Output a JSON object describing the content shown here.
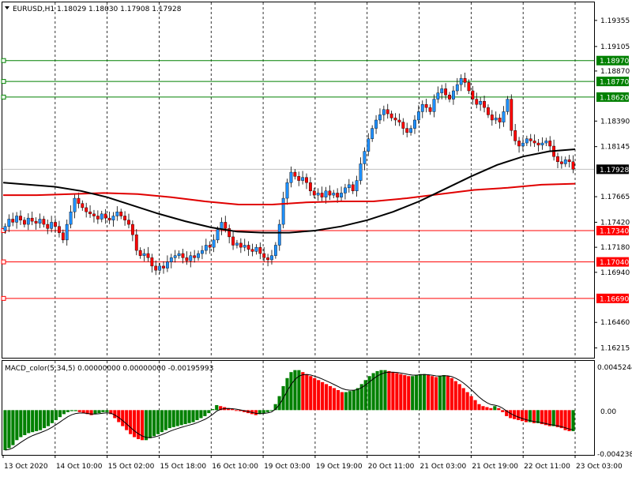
{
  "header": {
    "triangle_icon": "triangle-down-icon",
    "text": "EURUSD,H1  1.18029 1.18030 1.17908 1.17928"
  },
  "macd": {
    "label": "MACD_color(5,34,5) 0.00000000 0.00000000 -0.00195993",
    "max_label": "0.0045244",
    "zero_label": "0.00",
    "min_label": "-0.004238",
    "range": [
      -0.004238,
      0.0045244
    ],
    "values": [
      -0.004,
      -0.0038,
      -0.0035,
      -0.003,
      -0.0027,
      -0.0025,
      -0.0023,
      -0.0022,
      -0.0021,
      -0.002,
      -0.0018,
      -0.0016,
      -0.0013,
      -0.001,
      -0.0007,
      -0.0004,
      -0.0002,
      -0.0001,
      -0.0001,
      -0.0002,
      -0.0003,
      -0.0004,
      -0.0005,
      -0.0004,
      -0.0003,
      -0.0002,
      -0.0002,
      -0.0004,
      -0.0008,
      -0.0012,
      -0.0016,
      -0.002,
      -0.0024,
      -0.0027,
      -0.0029,
      -0.003,
      -0.003,
      -0.0028,
      -0.0026,
      -0.0024,
      -0.0022,
      -0.002,
      -0.0018,
      -0.0017,
      -0.0016,
      -0.0015,
      -0.0014,
      -0.0013,
      -0.0012,
      -0.001,
      -0.0008,
      -0.0006,
      -0.0003,
      0.0001,
      0.0005,
      0.0004,
      0.0003,
      0.0002,
      0.0001,
      0.0,
      -0.0001,
      -0.0002,
      -0.0003,
      -0.0004,
      -0.0005,
      -0.0004,
      -0.0003,
      -0.0002,
      0.0,
      0.0006,
      0.0014,
      0.0024,
      0.0032,
      0.0038,
      0.004,
      0.004,
      0.0038,
      0.0036,
      0.0034,
      0.0032,
      0.003,
      0.0028,
      0.0026,
      0.0024,
      0.0022,
      0.002,
      0.0018,
      0.0018,
      0.0019,
      0.002,
      0.0022,
      0.0026,
      0.003,
      0.0034,
      0.0037,
      0.0039,
      0.004,
      0.004,
      0.0039,
      0.0038,
      0.0037,
      0.0036,
      0.0035,
      0.0034,
      0.0034,
      0.0035,
      0.0036,
      0.0036,
      0.0035,
      0.0034,
      0.0033,
      0.0034,
      0.0035,
      0.0034,
      0.0032,
      0.0029,
      0.0026,
      0.0022,
      0.0018,
      0.0014,
      0.001,
      0.0006,
      0.0004,
      0.0003,
      0.0002,
      0.0004,
      0.0002,
      -0.0002,
      -0.0006,
      -0.0008,
      -0.0009,
      -0.001,
      -0.0011,
      -0.0012,
      -0.0012,
      -0.0013,
      -0.0013,
      -0.0014,
      -0.0015,
      -0.0016,
      -0.0016,
      -0.0017,
      -0.0018,
      -0.002,
      -0.0021,
      -0.0021
    ]
  },
  "chart_data": {
    "type": "candlestick",
    "symbol": "EURUSD",
    "timeframe": "H1",
    "price_axis": {
      "ylim": [
        1.16121,
        1.19528
      ],
      "ticks": [
        "1.19355",
        "1.19105",
        "1.18870",
        "1.18390",
        "1.18145",
        "1.17665",
        "1.17420",
        "1.17180",
        "1.16940",
        "1.16460",
        "1.16215"
      ]
    },
    "time_axis": [
      "13 Oct 2020",
      "14 Oct 10:00",
      "15 Oct 02:00",
      "15 Oct 18:00",
      "16 Oct 10:00",
      "19 Oct 03:00",
      "19 Oct 19:00",
      "20 Oct 11:00",
      "21 Oct 03:00",
      "21 Oct 19:00",
      "22 Oct 11:00",
      "23 Oct 03:00"
    ],
    "current_price": {
      "label": "1.17928",
      "value": 1.17928,
      "color": "#000000"
    },
    "levels": [
      {
        "label": "1.18970",
        "value": 1.1897,
        "color": "#008000"
      },
      {
        "label": "1.18770",
        "value": 1.1877,
        "color": "#008000"
      },
      {
        "label": "1.18620",
        "value": 1.1862,
        "color": "#008000"
      },
      {
        "label": "1.17340",
        "value": 1.1734,
        "color": "#ff0000"
      },
      {
        "label": "1.17040",
        "value": 1.1704,
        "color": "#ff0000"
      },
      {
        "label": "1.16690",
        "value": 1.1669,
        "color": "#ff0000"
      }
    ],
    "closes": [
      1.1738,
      1.1745,
      1.1742,
      1.1748,
      1.1744,
      1.174,
      1.1746,
      1.1743,
      1.1741,
      1.1745,
      1.174,
      1.1736,
      1.1742,
      1.1738,
      1.1732,
      1.1725,
      1.174,
      1.1752,
      1.1765,
      1.176,
      1.1756,
      1.1752,
      1.175,
      1.1748,
      1.1745,
      1.175,
      1.1746,
      1.1744,
      1.1748,
      1.1752,
      1.1748,
      1.1744,
      1.174,
      1.173,
      1.1715,
      1.171,
      1.1712,
      1.1708,
      1.17,
      1.1696,
      1.17,
      1.1698,
      1.1704,
      1.1708,
      1.171,
      1.1712,
      1.1708,
      1.1705,
      1.171,
      1.1708,
      1.1712,
      1.1715,
      1.172,
      1.1718,
      1.1725,
      1.1735,
      1.1742,
      1.1736,
      1.1728,
      1.172,
      1.1722,
      1.1718,
      1.172,
      1.1716,
      1.1714,
      1.1718,
      1.1712,
      1.1708,
      1.1706,
      1.171,
      1.172,
      1.174,
      1.1765,
      1.178,
      1.179,
      1.1786,
      1.1782,
      1.1785,
      1.178,
      1.1772,
      1.1768,
      1.177,
      1.1766,
      1.1772,
      1.1768,
      1.177,
      1.1766,
      1.177,
      1.1775,
      1.1778,
      1.1772,
      1.1782,
      1.1798,
      1.181,
      1.1822,
      1.1832,
      1.184,
      1.1845,
      1.185,
      1.1846,
      1.1842,
      1.184,
      1.1838,
      1.1832,
      1.1828,
      1.1832,
      1.184,
      1.1848,
      1.1855,
      1.1852,
      1.1848,
      1.186,
      1.1866,
      1.187,
      1.1864,
      1.186,
      1.1868,
      1.1874,
      1.188,
      1.1876,
      1.1868,
      1.186,
      1.1855,
      1.1858,
      1.1852,
      1.1845,
      1.184,
      1.1842,
      1.1838,
      1.1848,
      1.186,
      1.183,
      1.182,
      1.1815,
      1.1818,
      1.1822,
      1.182,
      1.1818,
      1.1816,
      1.1818,
      1.182,
      1.1815,
      1.1805,
      1.18,
      1.1798,
      1.1802,
      1.18,
      1.17928
    ],
    "ma_black": [
      1.178,
      1.1778,
      1.1776,
      1.1772,
      1.1766,
      1.1758,
      1.175,
      1.1743,
      1.1737,
      1.1733,
      1.1732,
      1.1732,
      1.1734,
      1.1738,
      1.1744,
      1.1752,
      1.1762,
      1.1774,
      1.1786,
      1.1797,
      1.1805,
      1.181,
      1.1812
    ],
    "ma_red": [
      1.1768,
      1.1768,
      1.1769,
      1.177,
      1.1769,
      1.1766,
      1.1762,
      1.1759,
      1.1759,
      1.1761,
      1.1762,
      1.1762,
      1.1765,
      1.1769,
      1.1773,
      1.1775,
      1.1778,
      1.1779
    ]
  }
}
